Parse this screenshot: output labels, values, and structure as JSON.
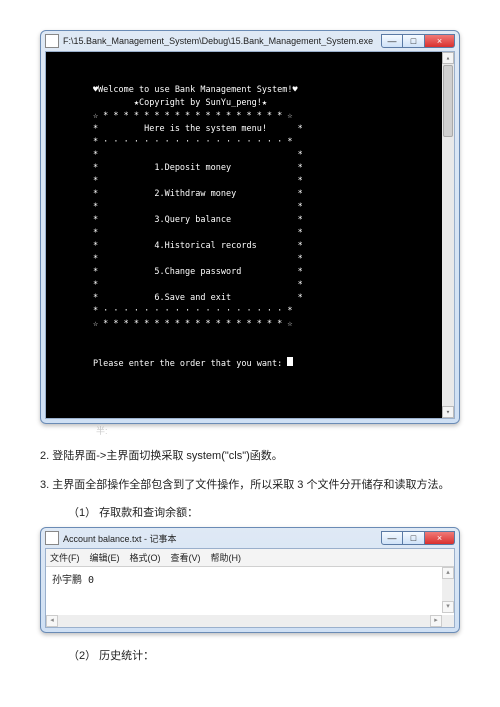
{
  "console_window": {
    "title": "F:\\15.Bank_Management_System\\Debug\\15.Bank_Management_System.exe",
    "min_label": "—",
    "max_label": "□",
    "close_label": "×",
    "lines": [
      "        ♥Welcome to use Bank Management System!♥",
      "                ★Copyright by SunYu_peng!★",
      "        ☆ * * * * * * * * * * * * * * * * * * ☆",
      "        *         Here is the system menu!      *",
      "        * · · · · · · · · · · · · · · · · · · *",
      "        *                                       *",
      "        *           1.Deposit money             *",
      "        *                                       *",
      "        *           2.Withdraw money            *",
      "        *                                       *",
      "        *           3.Query balance             *",
      "        *                                       *",
      "        *           4.Historical records        *",
      "        *                                       *",
      "        *           5.Change password           *",
      "        *                                       *",
      "        *           6.Save and exit             *",
      "        * · · · · · · · · · · · · · · · · · · *",
      "        ☆ * * * * * * * * * * * * * * * * * * ☆"
    ],
    "prompt": "        Please enter the order that you want: "
  },
  "caption": "半:",
  "body": {
    "item2": "2.   登陆界面->主界面切换采取 system(\"cls\")函数。",
    "item3": "3.   主界面全部操作全部包含到了文件操作，所以采取 3 个文件分开储存和读取方法。",
    "sub1": "（1）   存取款和查询余额：",
    "sub2": "（2）   历史统计："
  },
  "notepad": {
    "title": "Account balance.txt - 记事本",
    "menu": {
      "file": "文件(F)",
      "edit": "编辑(E)",
      "format": "格式(O)",
      "view": "查看(V)",
      "help": "帮助(H)"
    },
    "content": "孙宇鹏   0",
    "min_label": "—",
    "max_label": "□",
    "close_label": "×"
  }
}
